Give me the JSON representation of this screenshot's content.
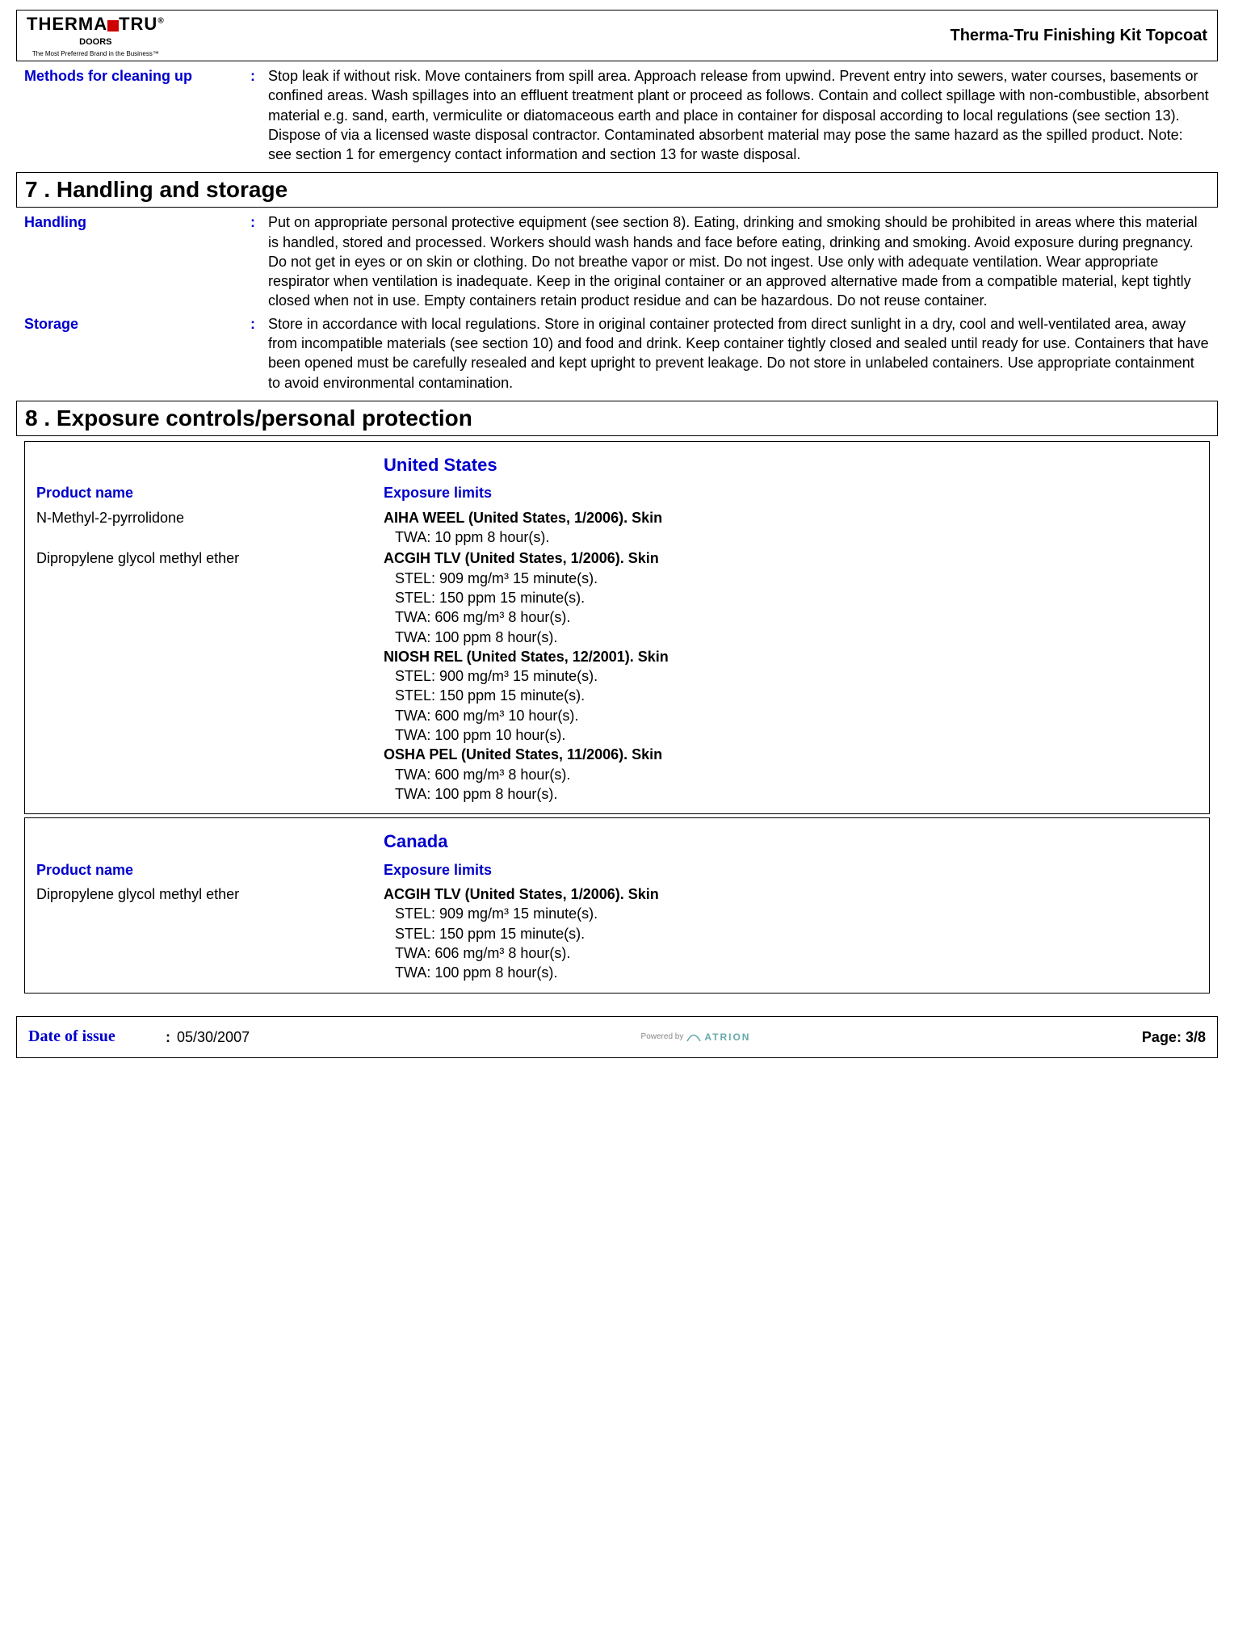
{
  "header": {
    "logo_main_left": "THERMA",
    "logo_main_right": "TRU",
    "logo_reg": "®",
    "logo_sub": "DOORS",
    "logo_tag": "The Most Preferred Brand in the Business™",
    "doc_title": "Therma-Tru Finishing Kit Topcoat"
  },
  "cleanup": {
    "label": "Methods for cleaning up",
    "body": "Stop leak if without risk.  Move containers from spill area.  Approach release from upwind. Prevent entry into sewers, water courses, basements or confined areas.  Wash spillages into an effluent treatment plant or proceed as follows.  Contain and collect spillage with non-combustible, absorbent material e.g. sand, earth, vermiculite or diatomaceous earth and place in container for disposal according to local regulations (see section 13).  Dispose of via a licensed waste disposal contractor.  Contaminated absorbent material may pose the same hazard as the spilled product.  Note: see section 1 for emergency contact information and section 13 for waste disposal."
  },
  "section7": {
    "heading": "7 .    Handling and storage",
    "handling_label": "Handling",
    "handling_body": "Put on appropriate personal protective equipment (see section 8).  Eating, drinking and smoking should be prohibited in areas where this material is handled, stored and processed.  Workers should wash hands and face before eating, drinking and smoking.  Avoid exposure during pregnancy.  Do not get in eyes or on skin or clothing.  Do not breathe vapor or mist.  Do not ingest.  Use only with adequate ventilation.  Wear appropriate respirator when ventilation is inadequate.  Keep in the original container or an approved alternative made from a compatible material, kept tightly closed when not in use.  Empty containers retain product residue and can be hazardous.  Do not reuse container.",
    "storage_label": "Storage",
    "storage_body": "Store in accordance with local regulations.  Store in original container protected from direct sunlight in a dry, cool and well-ventilated area, away from incompatible materials (see section 10) and food and drink.  Keep container tightly closed and sealed until ready for use.  Containers that have been opened must be carefully resealed and kept upright to prevent leakage.  Do not store in unlabeled containers.  Use appropriate containment to avoid environmental contamination."
  },
  "section8": {
    "heading": "8 .    Exposure controls/personal protection",
    "us_heading": "United States",
    "col_product": "Product name",
    "col_limits": "Exposure limits",
    "us_rows": [
      {
        "name": "N-Methyl-2-pyrrolidone",
        "limits": [
          {
            "head": "AIHA WEEL (United States, 1/2006).  Skin",
            "vals": [
              "TWA: 10 ppm 8 hour(s)."
            ]
          }
        ]
      },
      {
        "name": "Dipropylene glycol methyl ether",
        "limits": [
          {
            "head": "ACGIH TLV (United States, 1/2006).  Skin",
            "vals": [
              "STEL: 909 mg/m³ 15 minute(s).",
              "STEL: 150 ppm 15 minute(s).",
              "TWA: 606 mg/m³ 8 hour(s).",
              "TWA: 100 ppm 8 hour(s)."
            ]
          },
          {
            "head": "NIOSH REL (United States, 12/2001).  Skin",
            "vals": [
              "STEL: 900 mg/m³ 15 minute(s).",
              "STEL: 150 ppm 15 minute(s).",
              "TWA: 600 mg/m³ 10 hour(s).",
              "TWA: 100 ppm 10 hour(s)."
            ]
          },
          {
            "head": "OSHA PEL (United States, 11/2006).  Skin",
            "vals": [
              "TWA: 600 mg/m³ 8 hour(s).",
              "TWA: 100 ppm 8 hour(s)."
            ]
          }
        ]
      }
    ],
    "ca_heading": "Canada",
    "ca_rows": [
      {
        "name": "Dipropylene glycol methyl ether",
        "limits": [
          {
            "head": "ACGIH TLV (United States, 1/2006).  Skin",
            "vals": [
              "STEL: 909 mg/m³ 15 minute(s).",
              "STEL: 150 ppm 15 minute(s).",
              "TWA: 606 mg/m³ 8 hour(s).",
              "TWA: 100 ppm 8 hour(s)."
            ]
          }
        ]
      }
    ]
  },
  "footer": {
    "date_label": "Date of issue",
    "date_value": "05/30/2007",
    "powered": "Powered by",
    "brand": "ATRION",
    "page_label": "Page:",
    "page_value": "3/8"
  }
}
